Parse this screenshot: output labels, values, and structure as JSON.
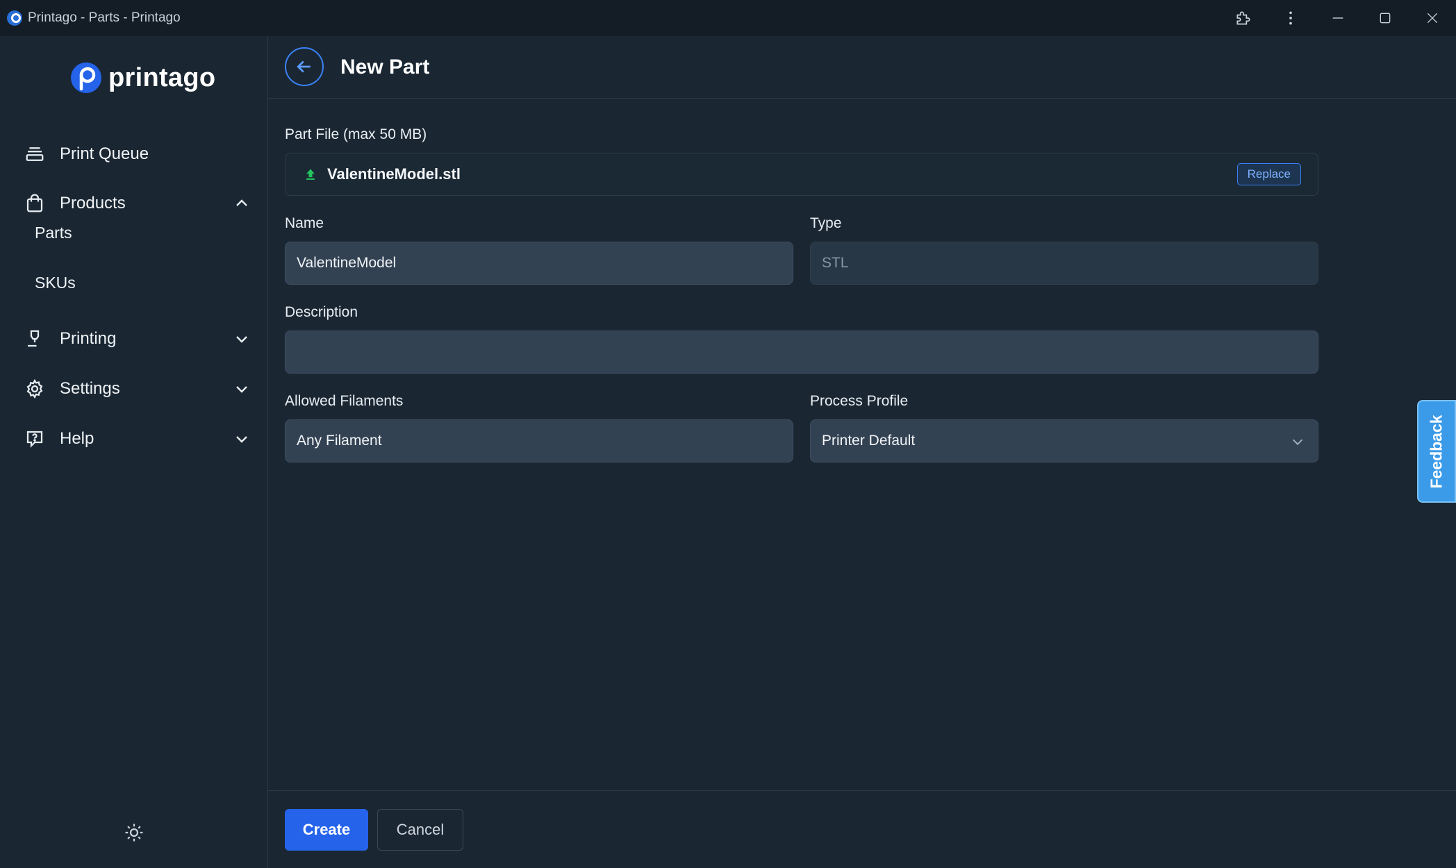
{
  "window": {
    "title": "Printago - Parts - Printago"
  },
  "sidebar": {
    "logo_text": "printago",
    "items": [
      {
        "label": "Print Queue",
        "icon": "queue-icon"
      },
      {
        "label": "Products",
        "icon": "bag-icon",
        "expanded": true
      },
      {
        "label": "Printing",
        "icon": "nozzle-icon"
      },
      {
        "label": "Settings",
        "icon": "gear-icon"
      },
      {
        "label": "Help",
        "icon": "help-icon"
      }
    ],
    "sub_items": [
      {
        "label": "Parts"
      },
      {
        "label": "SKUs"
      }
    ]
  },
  "header": {
    "title": "New Part"
  },
  "form": {
    "part_file": {
      "label": "Part File (max 50 MB)",
      "file_name": "ValentineModel.stl",
      "replace_label": "Replace"
    },
    "name": {
      "label": "Name",
      "value": "ValentineModel"
    },
    "type": {
      "label": "Type",
      "value": "STL"
    },
    "description": {
      "label": "Description",
      "value": ""
    },
    "allowed_filaments": {
      "label": "Allowed Filaments",
      "value": "Any Filament"
    },
    "process_profile": {
      "label": "Process Profile",
      "value": "Printer Default"
    }
  },
  "footer": {
    "create_label": "Create",
    "cancel_label": "Cancel"
  },
  "feedback": {
    "label": "Feedback"
  },
  "colors": {
    "accent": "#2563eb",
    "background": "#1a2733",
    "feedback": "#3b9be8"
  }
}
